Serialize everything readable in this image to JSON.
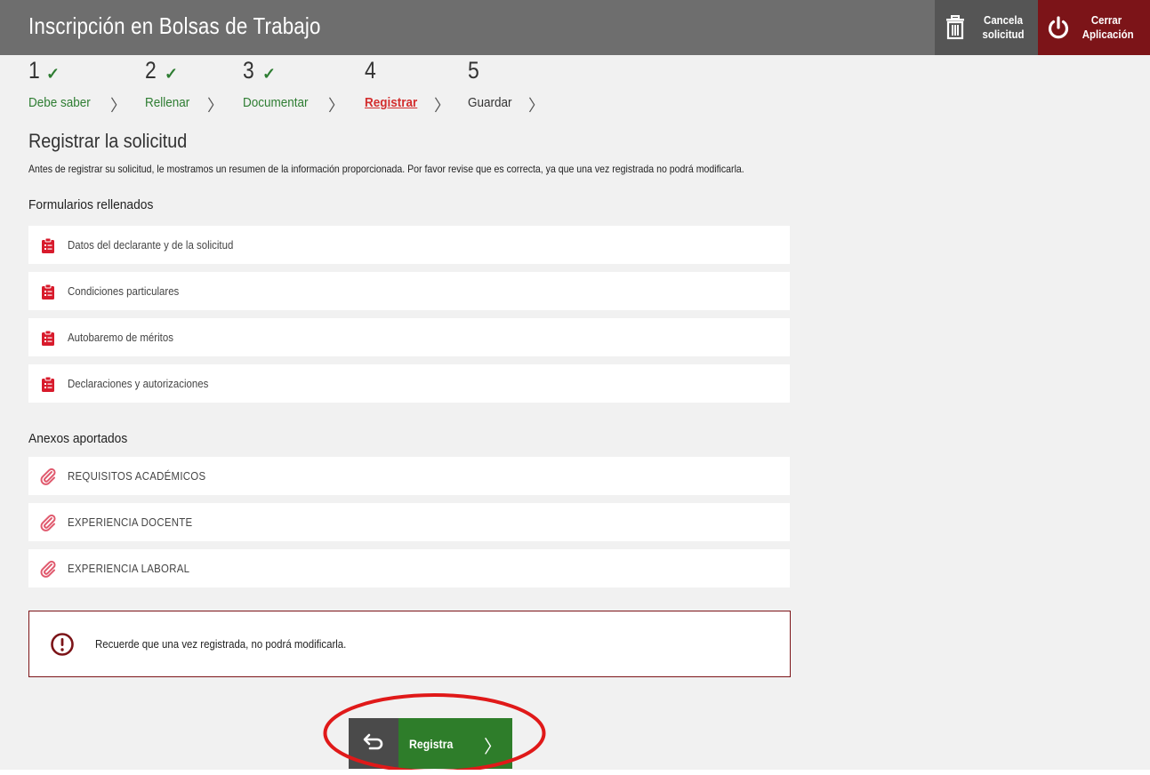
{
  "header": {
    "title": "Inscripción en Bolsas de Trabajo",
    "cancel": {
      "line1": "Cancela",
      "line2": "solicitud",
      "icon": "trash-icon"
    },
    "close": {
      "line1": "Cerrar",
      "line2": "Aplicación",
      "icon": "power-icon"
    }
  },
  "steps": [
    {
      "number": "1",
      "label": "Debe saber",
      "state": "done"
    },
    {
      "number": "2",
      "label": "Rellenar",
      "state": "done"
    },
    {
      "number": "3",
      "label": "Documentar",
      "state": "done"
    },
    {
      "number": "4",
      "label": "Registrar",
      "state": "active"
    },
    {
      "number": "5",
      "label": "Guardar",
      "state": "pending"
    }
  ],
  "main": {
    "title": "Registrar la solicitud",
    "intro": "Antes de registrar su solicitud, le mostramos un resumen de la información proporcionada. Por favor revise que es correcta, ya que una vez registrada no podrá modificarla.",
    "forms_heading": "Formularios rellenados",
    "forms": [
      "Datos del declarante y de la solicitud",
      "Condiciones particulares",
      "Autobaremo de méritos",
      "Declaraciones y autorizaciones"
    ],
    "annex_heading": "Anexos aportados",
    "annexes": [
      "REQUISITOS ACADÉMICOS",
      "EXPERIENCIA DOCENTE",
      "EXPERIENCIA LABORAL"
    ],
    "warning": "Recuerde que una vez registrada, no podrá modificarla.",
    "submit_label": "Registra"
  },
  "colors": {
    "header_bg": "#6e6e6e",
    "close_bg": "#7c1418",
    "done_green": "#2e7d32",
    "active_red": "#d32f2f",
    "submit_green": "#2e7d2a",
    "highlight": "#e01919"
  }
}
